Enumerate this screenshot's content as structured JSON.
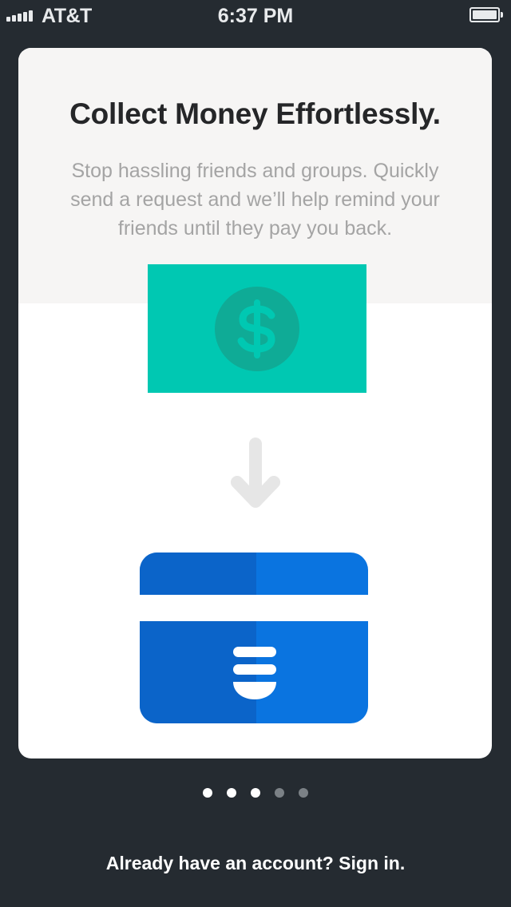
{
  "status_bar": {
    "carrier": "AT&T",
    "time": "6:37 PM",
    "icons": [
      "signal-bars-icon",
      "battery-icon"
    ]
  },
  "onboarding": {
    "title": "Collect Money Effortlessly.",
    "description": "Stop hassling friends and groups. Quickly send a request and we’ll help remind your friends until they pay you back.",
    "illustration": {
      "top": "dollar-bill-icon",
      "middle": "arrow-down-icon",
      "bottom": "payment-card-icon"
    },
    "colors": {
      "bill": "#00c8b2",
      "coin": "#0fab96",
      "card": "#0a74e0",
      "card_shade": "#0b64c9",
      "arrow": "#e6e6e6"
    }
  },
  "pager": {
    "total": 5,
    "active_dots": 3
  },
  "footer": {
    "signin_text": "Already have an account? Sign in."
  }
}
